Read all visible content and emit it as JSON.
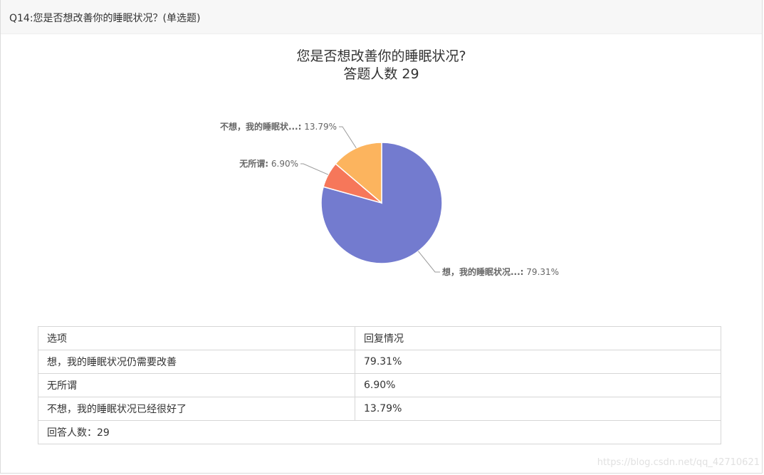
{
  "header": {
    "question": "Q14:您是否想改善你的睡眠状况？(单选题)"
  },
  "chart_data": {
    "type": "pie",
    "title": "您是否想改善你的睡眠状况?",
    "subtitle": "答题人数 29",
    "slices": [
      {
        "label": "想，我的睡眠状况...",
        "pct_text": "79.31%",
        "value": 79.31,
        "color": "#737bcf"
      },
      {
        "label": "无所谓",
        "pct_text": "6.90%",
        "value": 6.9,
        "color": "#f6775a"
      },
      {
        "label": "不想，我的睡眠状...",
        "pct_text": "13.79%",
        "value": 13.79,
        "color": "#fcb45e"
      }
    ]
  },
  "table": {
    "headers": [
      "选项",
      "回复情况"
    ],
    "rows": [
      [
        "想，我的睡眠状况仍需要改善",
        "79.31%"
      ],
      [
        "无所谓",
        "6.90%"
      ],
      [
        "不想，我的睡眠状况已经很好了",
        "13.79%"
      ]
    ],
    "footer": "回答人数：29"
  },
  "watermark": "https://blog.csdn.net/qq_42710621"
}
